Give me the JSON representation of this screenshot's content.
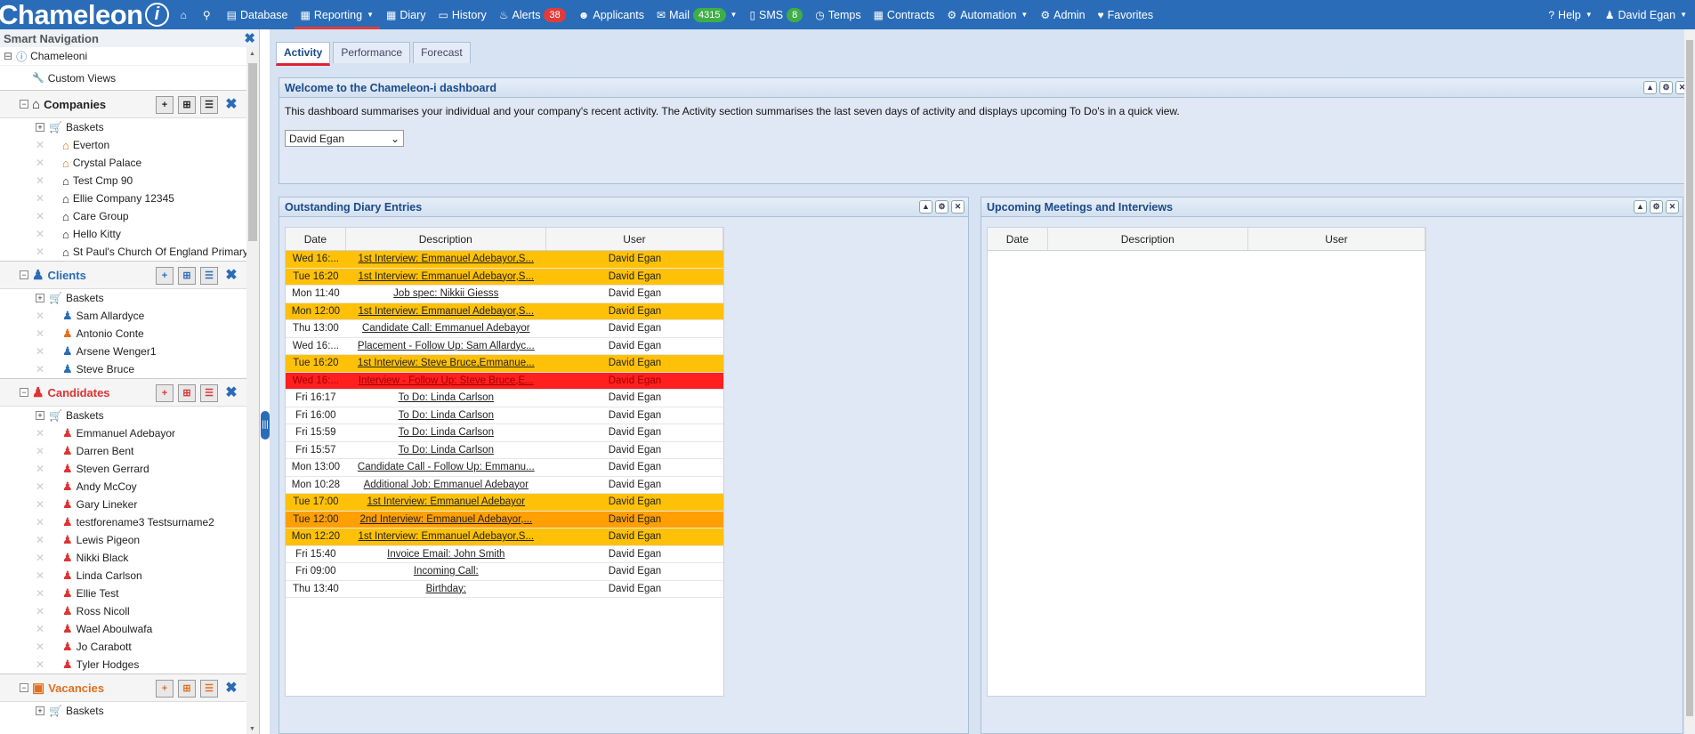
{
  "app": {
    "logo": "Chameleon",
    "logo_badge": "i"
  },
  "topnav": {
    "items": [
      {
        "id": "home",
        "icon": "home-icon",
        "glyph": "⌂",
        "label": ""
      },
      {
        "id": "search",
        "icon": "search-icon",
        "glyph": "⚲",
        "label": ""
      },
      {
        "id": "database",
        "icon": "database-icon",
        "glyph": "▤",
        "label": "Database"
      },
      {
        "id": "reporting",
        "icon": "bar-chart-icon",
        "glyph": "▦",
        "label": "Reporting",
        "caret": true,
        "active": true
      },
      {
        "id": "diary",
        "icon": "calendar-icon",
        "glyph": "▦",
        "label": "Diary"
      },
      {
        "id": "history",
        "icon": "book-icon",
        "glyph": "▭",
        "label": "History"
      },
      {
        "id": "alerts",
        "icon": "bulb-icon",
        "glyph": "♨",
        "label": "Alerts",
        "badge": "38",
        "badge_color": "red"
      },
      {
        "id": "applicants",
        "icon": "users-icon",
        "glyph": "☻",
        "label": "Applicants"
      },
      {
        "id": "mail",
        "icon": "envelope-icon",
        "glyph": "✉",
        "label": "Mail",
        "badge": "4315",
        "badge_color": "green",
        "caret": true
      },
      {
        "id": "sms",
        "icon": "mobile-icon",
        "glyph": "▯",
        "label": "SMS",
        "badge": "8",
        "badge_color": "green"
      },
      {
        "id": "temps",
        "icon": "clock-icon",
        "glyph": "◷",
        "label": "Temps"
      },
      {
        "id": "contracts",
        "icon": "table-icon",
        "glyph": "▦",
        "label": "Contracts"
      },
      {
        "id": "automation",
        "icon": "gears-icon",
        "glyph": "⚙",
        "label": "Automation",
        "caret": true
      },
      {
        "id": "admin",
        "icon": "gear-icon",
        "glyph": "⚙",
        "label": "Admin"
      },
      {
        "id": "favorites",
        "icon": "heart-icon",
        "glyph": "♥",
        "label": "Favorites"
      }
    ],
    "right": [
      {
        "id": "help",
        "icon": "question-icon",
        "glyph": "?",
        "label": "Help",
        "caret": true
      },
      {
        "id": "user",
        "icon": "user-icon",
        "glyph": "♟",
        "label": "David Egan",
        "caret": true
      }
    ]
  },
  "sidebar": {
    "title": "Smart Navigation",
    "root": "Chameleoni",
    "custom_views": "Custom Views",
    "baskets_label": "Baskets",
    "sections": [
      {
        "id": "companies",
        "label": "Companies",
        "color": "#222",
        "icon": "house-icon",
        "items": [
          "Everton",
          "Crystal Palace",
          "Test Cmp 90",
          "Ellie Company 12345",
          "Care Group",
          "Hello Kitty",
          "St Paul's Church Of England Primary"
        ],
        "item_colors": [
          "#e07020",
          "#e07020",
          "#222",
          "#222",
          "#222",
          "#222",
          "#222"
        ]
      },
      {
        "id": "clients",
        "label": "Clients",
        "color": "#2a6cb8",
        "icon": "user-icon",
        "items": [
          "Sam Allardyce",
          "Antonio Conte",
          "Arsene Wenger1",
          "Steve Bruce"
        ],
        "item_colors": [
          "#2a6cb8",
          "#e07020",
          "#2a6cb8",
          "#2a6cb8"
        ]
      },
      {
        "id": "candidates",
        "label": "Candidates",
        "color": "#d33",
        "icon": "user-icon",
        "items": [
          "Emmanuel Adebayor",
          "Darren Bent",
          "Steven Gerrard",
          "Andy McCoy",
          "Gary Lineker",
          "testforename3 Testsurname2",
          "Lewis Pigeon",
          "Nikki Black",
          "Linda Carlson",
          "Ellie Test",
          "Ross Nicoll",
          "Wael Aboulwafa",
          "Jo Carabott",
          "Tyler Hodges"
        ],
        "item_colors": [
          "#d33",
          "#d33",
          "#d33",
          "#d33",
          "#d33",
          "#d33",
          "#d33",
          "#d33",
          "#d33",
          "#d33",
          "#d33",
          "#d33",
          "#d33",
          "#d33"
        ]
      },
      {
        "id": "vacancies",
        "label": "Vacancies",
        "color": "#e07020",
        "icon": "briefcase-icon",
        "items": [],
        "item_colors": []
      }
    ]
  },
  "tabs": [
    {
      "label": "Activity",
      "active": true
    },
    {
      "label": "Performance",
      "active": false
    },
    {
      "label": "Forecast",
      "active": false
    }
  ],
  "welcome": {
    "title": "Welcome to the Chameleon-i dashboard",
    "text": "This dashboard summarises your individual and your company's recent activity. The Activity section summarises the last seven days of activity and displays upcoming To Do's in a quick view.",
    "select_value": "David Egan"
  },
  "diary": {
    "title": "Outstanding Diary Entries",
    "columns": [
      "Date",
      "Description",
      "User"
    ],
    "rows": [
      {
        "date": "Wed 16:...",
        "desc": "1st Interview: Emmanuel Adebayor,S...",
        "user": "David Egan",
        "bg": "yellow"
      },
      {
        "date": "Tue 16:20",
        "desc": "1st Interview: Emmanuel Adebayor,S...",
        "user": "David Egan",
        "bg": "yellow"
      },
      {
        "date": "Mon 11:40",
        "desc": "Job spec: Nikkii Giesss",
        "user": "David Egan",
        "bg": "white"
      },
      {
        "date": "Mon 12:00",
        "desc": "1st Interview: Emmanuel Adebayor,S...",
        "user": "David Egan",
        "bg": "yellow"
      },
      {
        "date": "Thu 13:00",
        "desc": "Candidate Call: Emmanuel Adebayor",
        "user": "David Egan",
        "bg": "white"
      },
      {
        "date": "Wed 16:...",
        "desc": "Placement - Follow Up: Sam Allardyc...",
        "user": "David Egan",
        "bg": "white"
      },
      {
        "date": "Tue 16:20",
        "desc": "1st Interview: Steve Bruce,Emmanue...",
        "user": "David Egan",
        "bg": "yellow"
      },
      {
        "date": "Wed 16:...",
        "desc": "Interview - Follow Up: Steve Bruce,E...",
        "user": "David Egan",
        "bg": "red"
      },
      {
        "date": "Fri 16:17",
        "desc": "To Do: Linda Carlson",
        "user": "David Egan",
        "bg": "white"
      },
      {
        "date": "Fri 16:00",
        "desc": "To Do: Linda Carlson",
        "user": "David Egan",
        "bg": "white"
      },
      {
        "date": "Fri 15:59",
        "desc": "To Do: Linda Carlson",
        "user": "David Egan",
        "bg": "white"
      },
      {
        "date": "Fri 15:57",
        "desc": "To Do: Linda Carlson",
        "user": "David Egan",
        "bg": "white"
      },
      {
        "date": "Mon 13:00",
        "desc": "Candidate Call - Follow Up: Emmanu...",
        "user": "David Egan",
        "bg": "white"
      },
      {
        "date": "Mon 10:28",
        "desc": "Additional Job: Emmanuel Adebayor",
        "user": "David Egan",
        "bg": "white"
      },
      {
        "date": "Tue 17:00",
        "desc": "1st Interview: Emmanuel Adebayor",
        "user": "David Egan",
        "bg": "yellow"
      },
      {
        "date": "Tue 12:00",
        "desc": "2nd Interview: Emmanuel Adebayor,...",
        "user": "David Egan",
        "bg": "orange"
      },
      {
        "date": "Mon 12:20",
        "desc": "1st Interview: Emmanuel Adebayor,S...",
        "user": "David Egan",
        "bg": "yellow"
      },
      {
        "date": "Fri 15:40",
        "desc": "Invoice Email: John Smith",
        "user": "David Egan",
        "bg": "white"
      },
      {
        "date": "Fri 09:00",
        "desc": "Incoming Call:",
        "user": "David Egan",
        "bg": "white"
      },
      {
        "date": "Thu 13:40",
        "desc": "Birthday:",
        "user": "David Egan",
        "bg": "white"
      }
    ]
  },
  "meetings": {
    "title": "Upcoming Meetings and Interviews",
    "columns": [
      "Date",
      "Description",
      "User"
    ]
  },
  "panel_tools": {
    "collapse": "▲",
    "settings": "⚙",
    "close": "✕"
  }
}
